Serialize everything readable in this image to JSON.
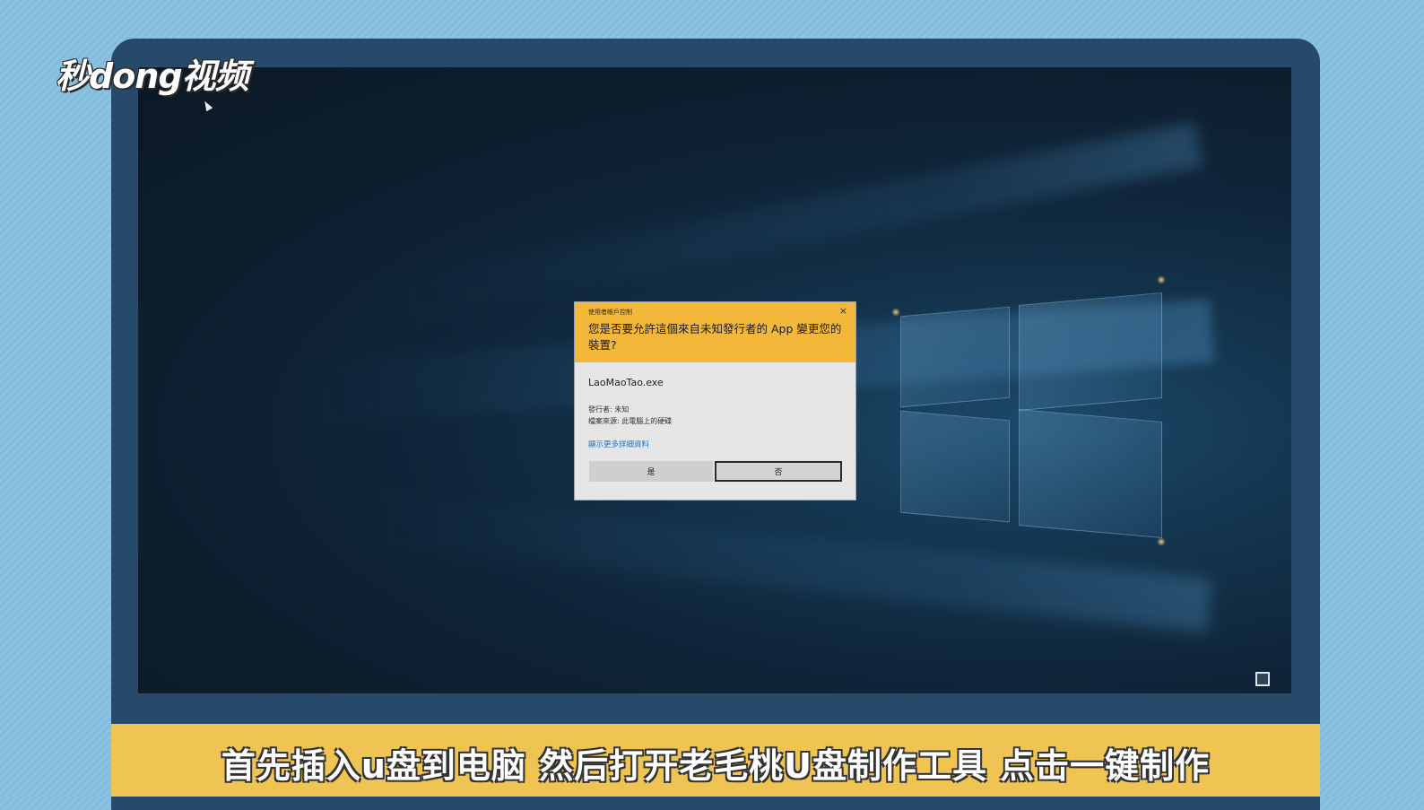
{
  "logo": {
    "text": "秒dong视频"
  },
  "dialog": {
    "small_title": "使用者帳戶控制",
    "close_glyph": "×",
    "question": "您是否要允許這個來自未知發行者的 App 變更您的裝置?",
    "file_name": "LaoMaoTao.exe",
    "publisher": "發行者: 未知",
    "file_origin": "檔案來源: 此電腦上的硬碟",
    "details_link": "顯示更多詳細資料",
    "yes_label": "是",
    "no_label": "否"
  },
  "subtitle": "首先插入u盘到电脑 然后打开老毛桃U盘制作工具 点击一键制作",
  "colors": {
    "dialog_header": "#f3b73a",
    "subtitle_bar": "#f0c453",
    "bezel": "#27496a",
    "link": "#1f74c7"
  }
}
